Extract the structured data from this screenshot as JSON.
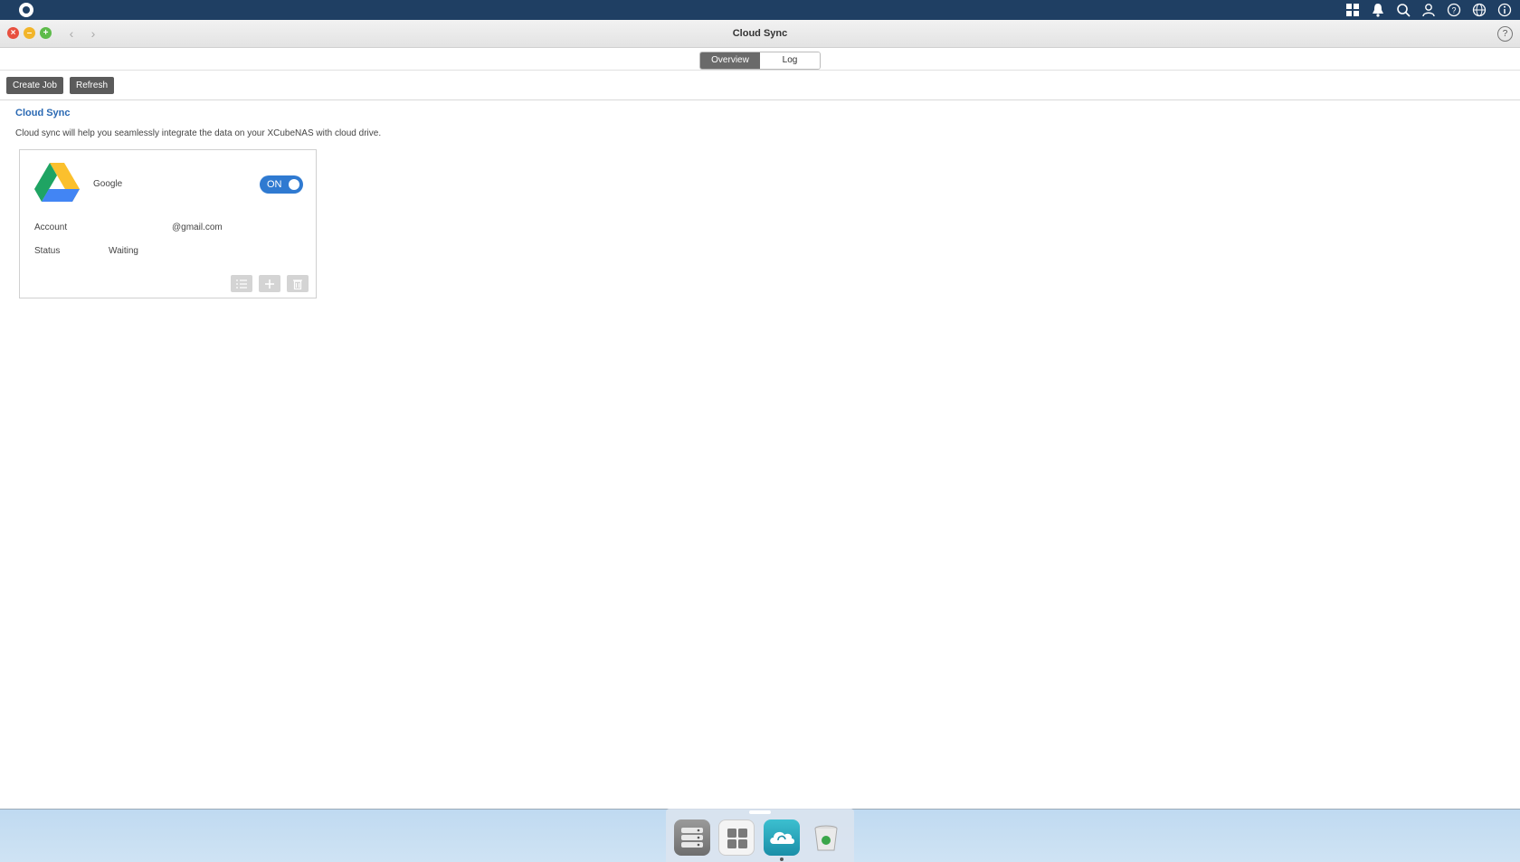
{
  "window": {
    "title": "Cloud Sync",
    "help_label": "?"
  },
  "tabs": [
    {
      "label": "Overview",
      "active": true
    },
    {
      "label": "Log",
      "active": false
    }
  ],
  "toolbar": {
    "create_label": "Create Job",
    "refresh_label": "Refresh"
  },
  "content": {
    "title": "Cloud Sync",
    "description": "Cloud sync will help you seamlessly integrate the data on your XCubeNAS with cloud drive."
  },
  "card": {
    "provider": "Google",
    "toggle_label": "ON",
    "account_label": "Account",
    "account_value": "@gmail.com",
    "status_label": "Status",
    "status_value": "Waiting"
  },
  "icons": {
    "topbar": [
      "apps-grid-icon",
      "bell-icon",
      "search-icon",
      "user-icon",
      "help-icon",
      "globe-icon",
      "info-icon"
    ],
    "card_actions": [
      "list-icon",
      "plus-icon",
      "trash-icon"
    ],
    "dock": [
      "storage-app-icon",
      "app-center-icon",
      "cloud-sync-app-icon",
      "recycle-bin-icon"
    ]
  },
  "colors": {
    "accent": "#2f7ad1",
    "topbar": "#1f3f63",
    "title_blue": "#2a69b3"
  }
}
